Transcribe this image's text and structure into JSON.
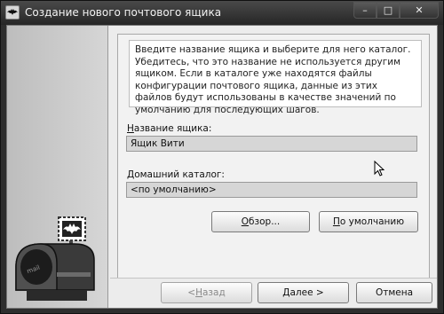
{
  "window": {
    "title": "Создание нового почтового ящика",
    "minimize_glyph": "–",
    "maximize_glyph": "□",
    "close_glyph": "✕"
  },
  "intro_text": "Введите название ящика и выберите для него каталог. Убедитесь, что это название не используется другим ящиком. Если в каталоге уже находятся файлы конфигурации почтового ящика, данные из этих файлов будут использованы в качестве значений по умолчанию для последующих шагов.",
  "mailbox_name": {
    "label_mnemonic": "Н",
    "label_rest": "азвание ящика:",
    "value": "Ящик Вити"
  },
  "home_folder": {
    "label_mnemonic": "Д",
    "label_rest": "омашний каталог:",
    "value": "<по умолчанию>"
  },
  "buttons": {
    "browse_mnemonic": "О",
    "browse_rest": "бзор...",
    "default_mnemonic": "П",
    "default_rest": "о умолчанию",
    "back_prefix": "< ",
    "back_mnemonic": "Н",
    "back_rest": "азад",
    "next_mnemonic": "Д",
    "next_rest": "алее >",
    "cancel": "Отмена"
  },
  "icons": {
    "app": "bat-logo-icon",
    "mailbox": "mailbox-illustration",
    "cursor": "mouse-pointer-icon"
  }
}
